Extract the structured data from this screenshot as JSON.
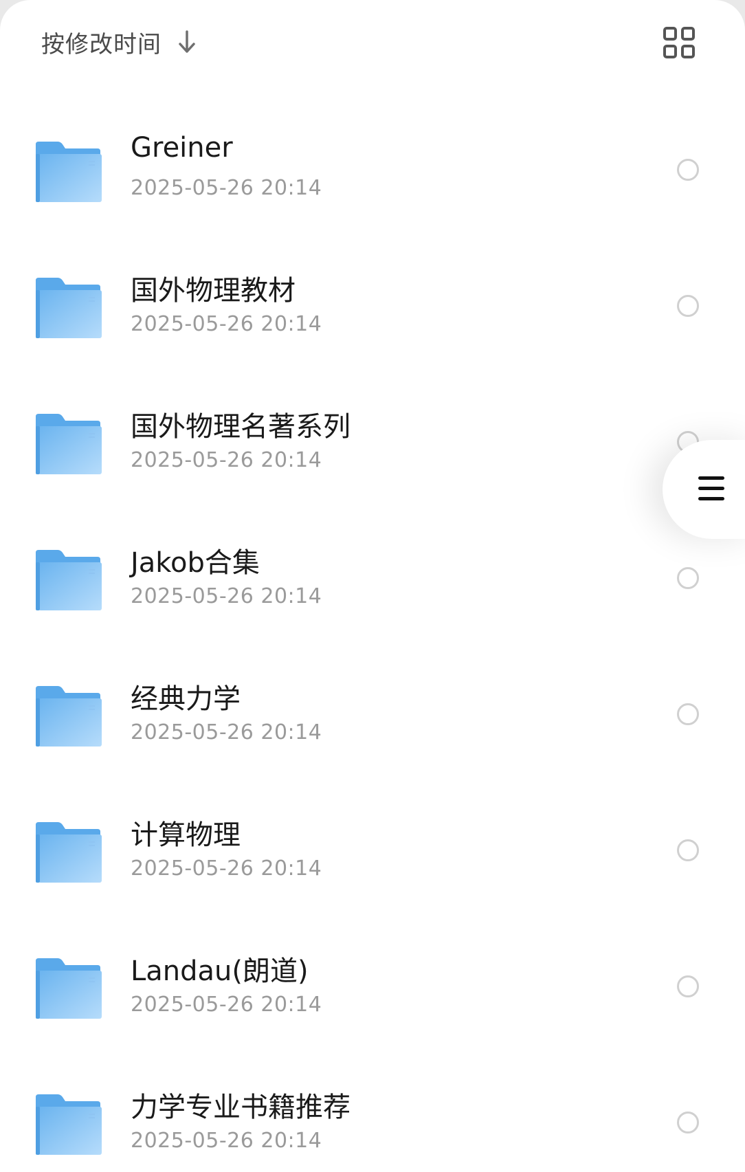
{
  "sort": {
    "label": "按修改时间",
    "direction_icon": "arrow-down-icon"
  },
  "view_toggle": {
    "icon": "grid-view-icon"
  },
  "colors": {
    "folder_top": "#5aa9ea",
    "folder_front_light": "#b6dcfb",
    "folder_front_dark": "#6bb4ef",
    "text_primary": "#1a1a1a",
    "text_secondary": "#9a9a9a",
    "radio_border": "#d0d0d0"
  },
  "files": [
    {
      "name": "Greiner",
      "modified": "2025-05-26 20:14",
      "icon": "folder-icon",
      "selected": false
    },
    {
      "name": "国外物理教材",
      "modified": "2025-05-26 20:14",
      "icon": "folder-icon",
      "selected": false
    },
    {
      "name": "国外物理名著系列",
      "modified": "2025-05-26 20:14",
      "icon": "folder-icon",
      "selected": false
    },
    {
      "name": "Jakob合集",
      "modified": "2025-05-26 20:14",
      "icon": "folder-icon",
      "selected": false
    },
    {
      "name": "经典力学",
      "modified": "2025-05-26 20:14",
      "icon": "folder-icon",
      "selected": false
    },
    {
      "name": "计算物理",
      "modified": "2025-05-26 20:14",
      "icon": "folder-icon",
      "selected": false
    },
    {
      "name": "Landau(朗道)",
      "modified": "2025-05-26 20:14",
      "icon": "folder-icon",
      "selected": false
    },
    {
      "name": "力学专业书籍推荐",
      "modified": "2025-05-26 20:14",
      "icon": "folder-icon",
      "selected": false
    }
  ],
  "side_menu": {
    "icon": "menu-icon"
  }
}
